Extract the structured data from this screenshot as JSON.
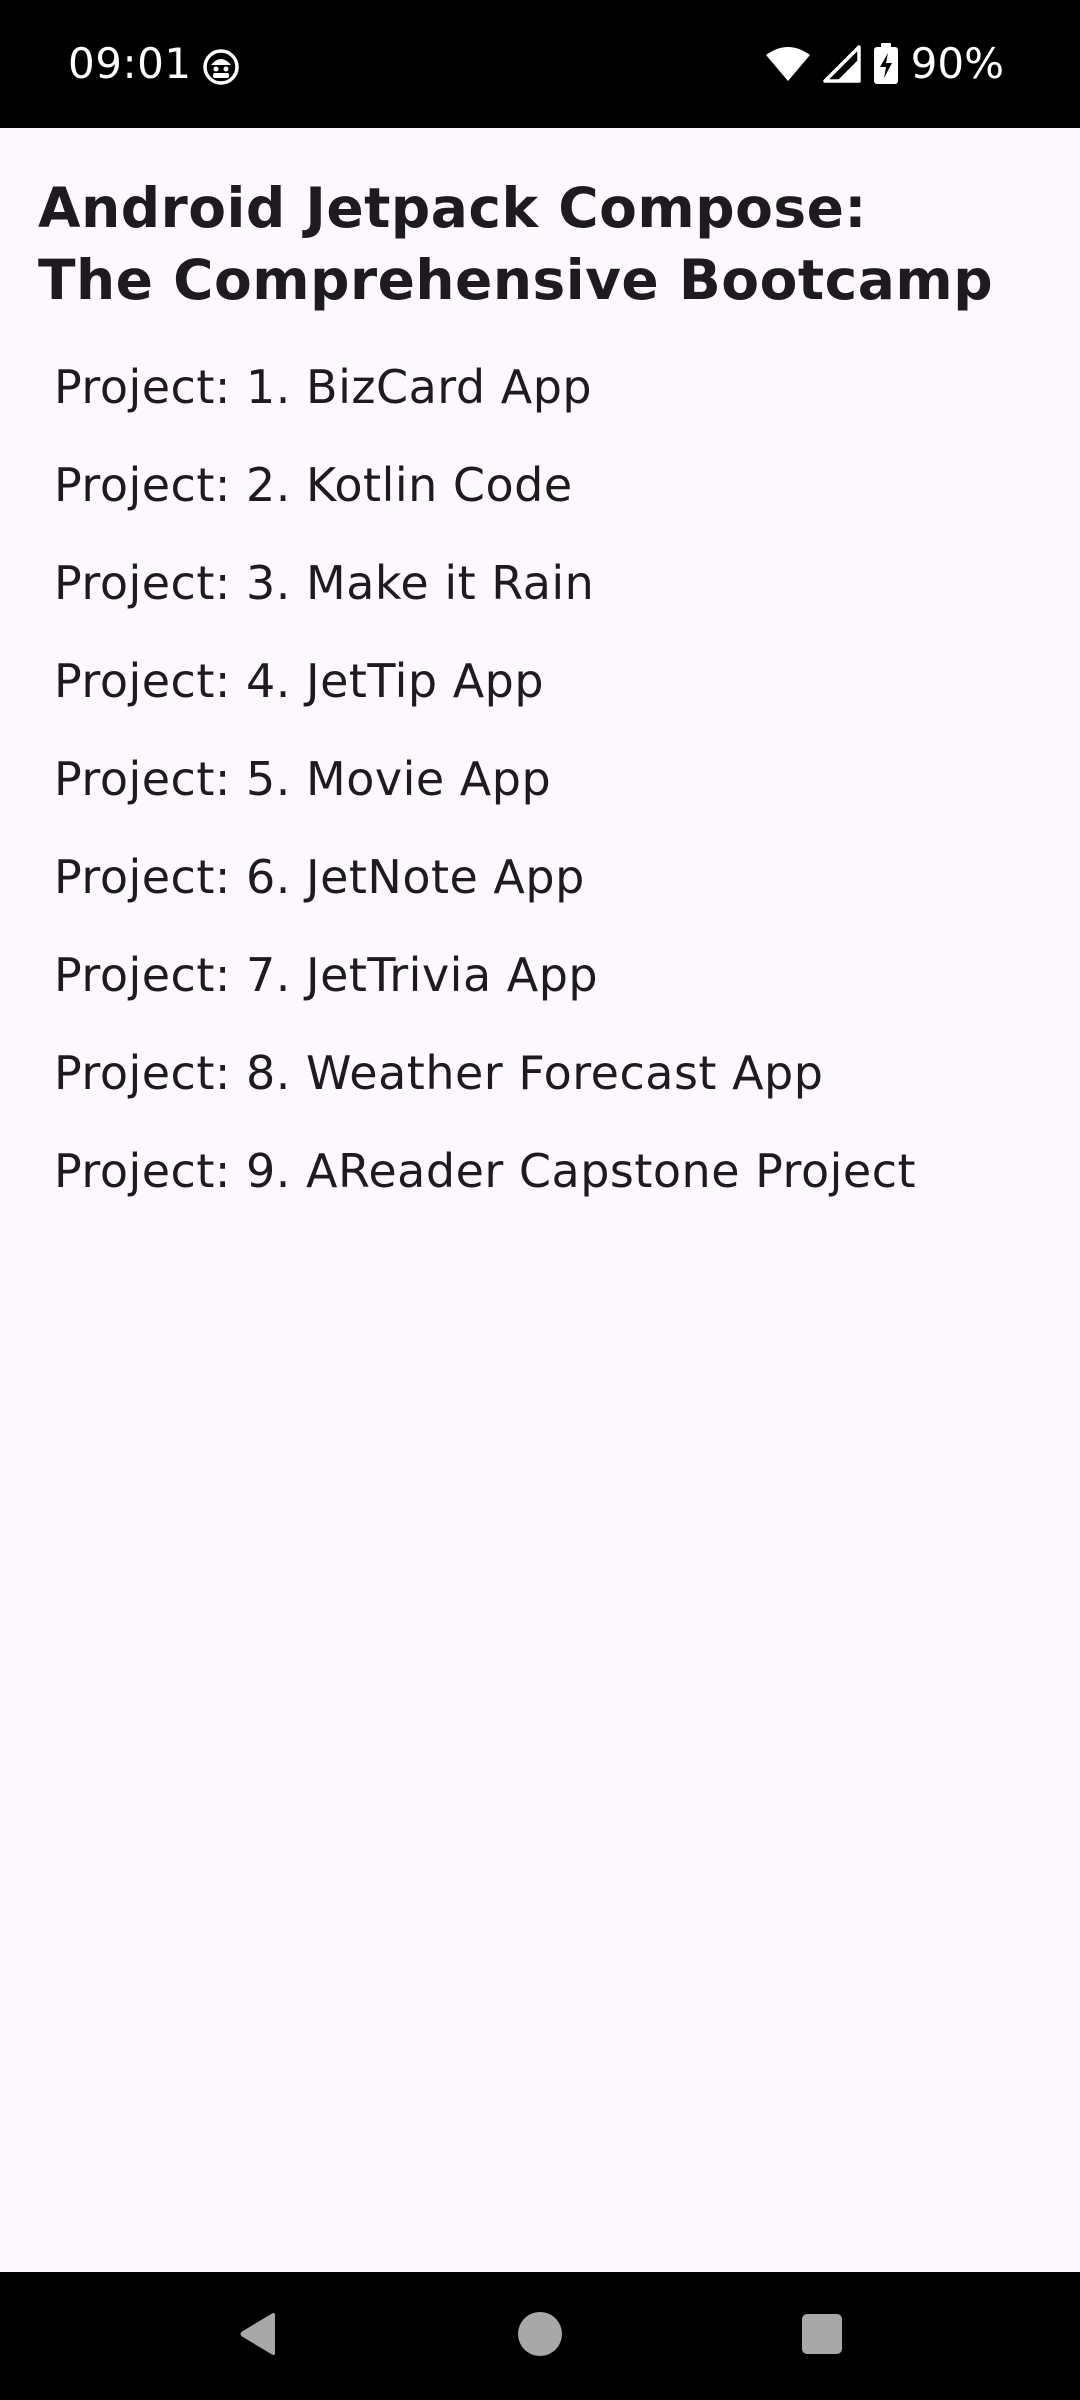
{
  "status_bar": {
    "time": "09:01",
    "app_icon": "app-notification-icon",
    "wifi_icon": "wifi-icon",
    "signal_icon": "cellular-signal-icon",
    "battery_icon": "battery-charging-icon",
    "battery_percent": "90%"
  },
  "page": {
    "title_line1": "Android Jetpack Compose:",
    "title_line2": "The Comprehensive Bootcamp"
  },
  "projects": [
    {
      "label": "Project: 1. BizCard App"
    },
    {
      "label": "Project: 2. Kotlin Code"
    },
    {
      "label": "Project: 3. Make it Rain"
    },
    {
      "label": "Project: 4. JetTip App"
    },
    {
      "label": "Project: 5. Movie App"
    },
    {
      "label": "Project: 6. JetNote App"
    },
    {
      "label": "Project: 7. JetTrivia App"
    },
    {
      "label": "Project: 8. Weather Forecast App"
    },
    {
      "label": "Project: 9. AReader Capstone Project"
    }
  ],
  "nav_bar": {
    "back_icon": "back-triangle-icon",
    "home_icon": "home-circle-icon",
    "recents_icon": "recents-square-icon"
  },
  "colors": {
    "background": "#fcf9fc",
    "text": "#1d1b20",
    "system_bars": "#000000",
    "nav_icons": "#a8a8a8"
  }
}
